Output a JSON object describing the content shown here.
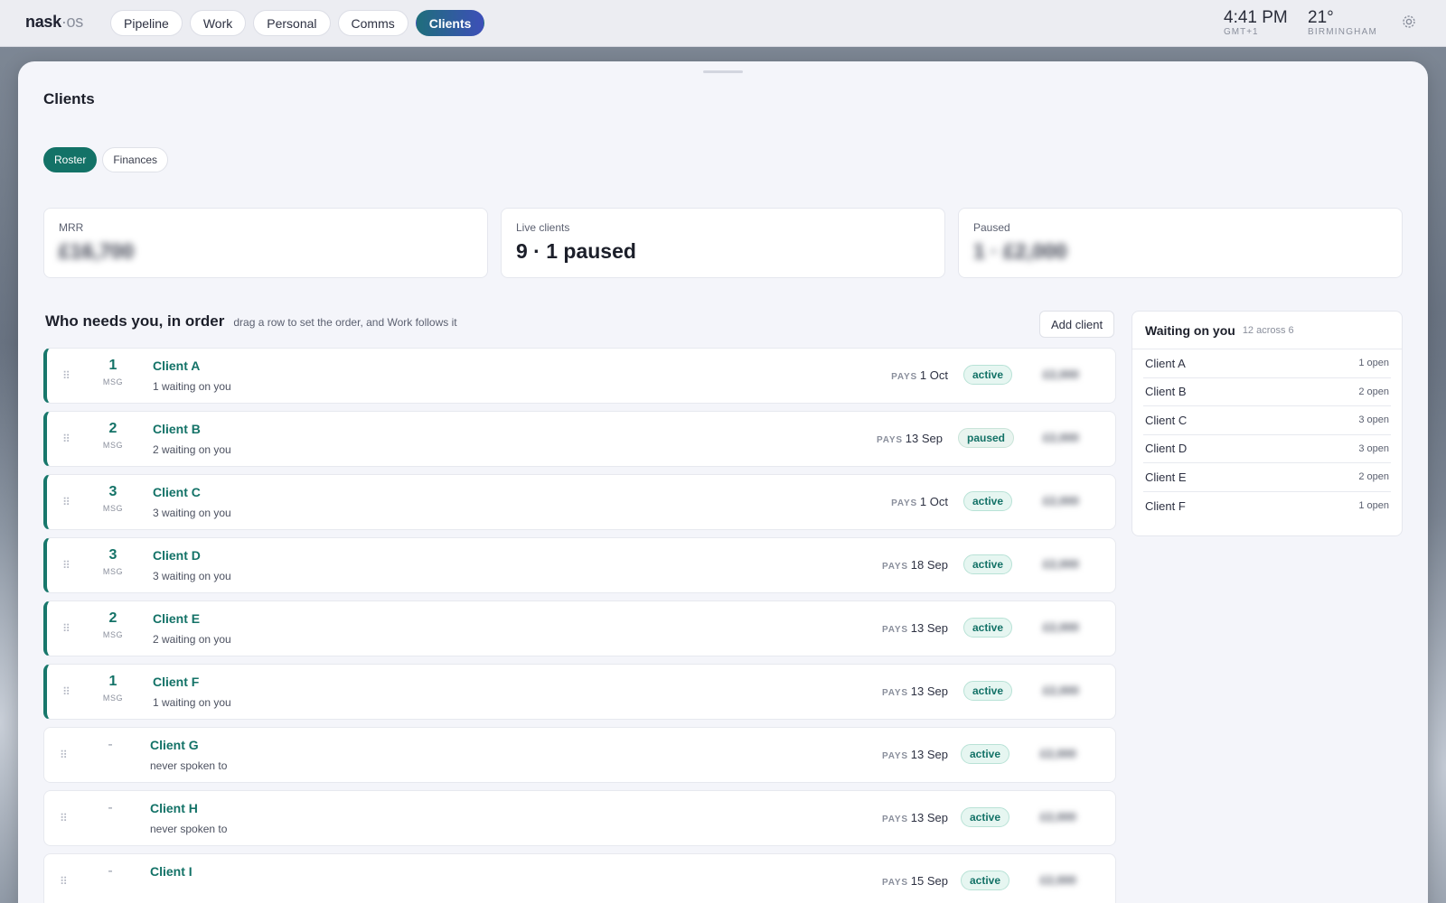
{
  "brand": {
    "main": "nask",
    "dot": "·",
    "suffix": "os"
  },
  "nav": [
    {
      "label": "Pipeline",
      "active": false
    },
    {
      "label": "Work",
      "active": false
    },
    {
      "label": "Personal",
      "active": false
    },
    {
      "label": "Comms",
      "active": false
    },
    {
      "label": "Clients",
      "active": true
    }
  ],
  "clock": {
    "time": "4:41 PM",
    "tz": "GMT+1"
  },
  "weather": {
    "temp": "21°",
    "city": "BIRMINGHAM"
  },
  "settings_icon": "gear-icon",
  "page": {
    "title": "Clients"
  },
  "subtabs": [
    {
      "label": "Roster",
      "active": true
    },
    {
      "label": "Finances",
      "active": false
    }
  ],
  "stats": [
    {
      "label": "MRR",
      "value": "£16,700",
      "blurred": true
    },
    {
      "label": "Live clients",
      "value": "9 · 1 paused",
      "blurred": false
    },
    {
      "label": "Paused",
      "value": "1 · £2,000",
      "blurred": true
    }
  ],
  "section": {
    "title": "Who needs you, in order",
    "hint": "drag a row to set the order, and Work follows it",
    "add_label": "Add client"
  },
  "rows": [
    {
      "count": "1",
      "unit": "MSG",
      "name": "Client A",
      "sub": "1 waiting on you",
      "pays_key": "PAYS",
      "pays": "1 Oct",
      "status": "active",
      "amount": "£2,000",
      "accent": true
    },
    {
      "count": "2",
      "unit": "MSG",
      "name": "Client B",
      "sub": "2 waiting on you",
      "pays_key": "PAYS",
      "pays": "13 Sep",
      "status": "paused",
      "amount": "£2,000",
      "accent": true
    },
    {
      "count": "3",
      "unit": "MSG",
      "name": "Client C",
      "sub": "3 waiting on you",
      "pays_key": "PAYS",
      "pays": "1 Oct",
      "status": "active",
      "amount": "£2,000",
      "accent": true
    },
    {
      "count": "3",
      "unit": "MSG",
      "name": "Client D",
      "sub": "3 waiting on you",
      "pays_key": "PAYS",
      "pays": "18 Sep",
      "status": "active",
      "amount": "£2,000",
      "accent": true
    },
    {
      "count": "2",
      "unit": "MSG",
      "name": "Client E",
      "sub": "2 waiting on you",
      "pays_key": "PAYS",
      "pays": "13 Sep",
      "status": "active",
      "amount": "£2,000",
      "accent": true
    },
    {
      "count": "1",
      "unit": "MSG",
      "name": "Client F",
      "sub": "1 waiting on you",
      "pays_key": "PAYS",
      "pays": "13 Sep",
      "status": "active",
      "amount": "£2,000",
      "accent": true
    },
    {
      "count": "-",
      "unit": "",
      "name": "Client G",
      "sub": "never spoken to",
      "pays_key": "PAYS",
      "pays": "13 Sep",
      "status": "active",
      "amount": "£2,000",
      "accent": false
    },
    {
      "count": "-",
      "unit": "",
      "name": "Client H",
      "sub": "never spoken to",
      "pays_key": "PAYS",
      "pays": "13 Sep",
      "status": "active",
      "amount": "£2,000",
      "accent": false
    },
    {
      "count": "-",
      "unit": "",
      "name": "Client I",
      "sub": "",
      "pays_key": "PAYS",
      "pays": "15 Sep",
      "status": "active",
      "amount": "£2,000",
      "accent": false
    }
  ],
  "waiting": {
    "title": "Waiting on you",
    "summary": "12 across 6",
    "items": [
      {
        "name": "Client A",
        "open": "1 open"
      },
      {
        "name": "Client B",
        "open": "2 open"
      },
      {
        "name": "Client C",
        "open": "3 open"
      },
      {
        "name": "Client D",
        "open": "3 open"
      },
      {
        "name": "Client E",
        "open": "2 open"
      },
      {
        "name": "Client F",
        "open": "1 open"
      }
    ]
  },
  "colors": {
    "accent": "#137267",
    "nav_active_start": "#1f6e7c",
    "nav_active_end": "#3d4fb8"
  }
}
